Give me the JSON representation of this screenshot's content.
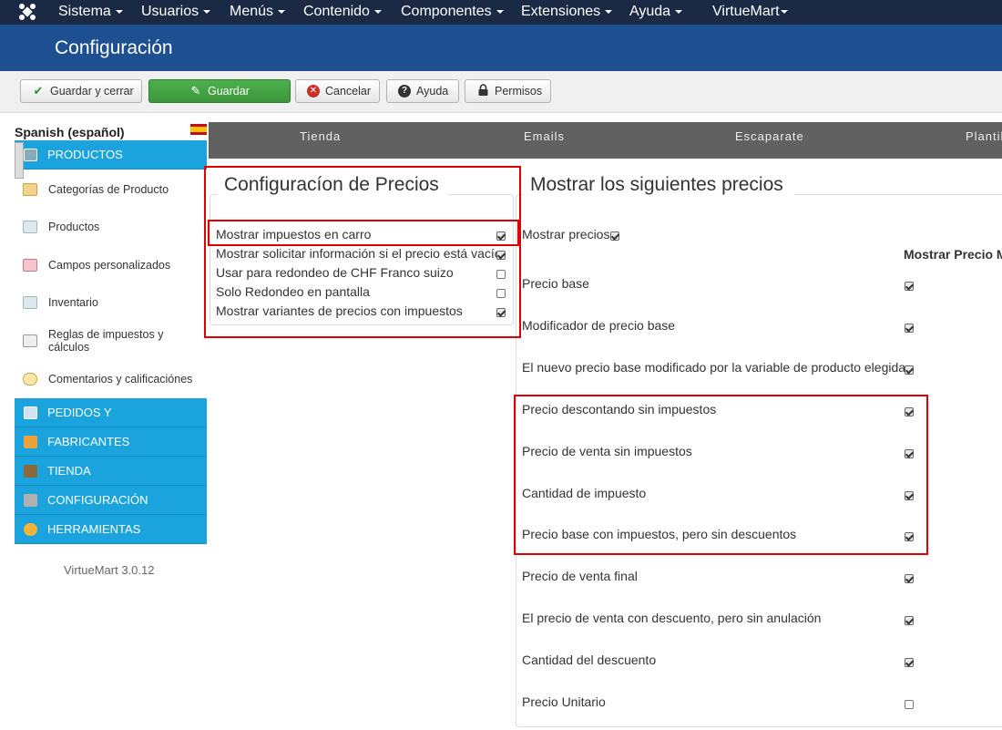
{
  "topnav": {
    "menus": [
      "Sistema",
      "Usuarios",
      "Menús",
      "Contenido",
      "Componentes",
      "Extensiones",
      "Ayuda",
      "VirtueMart"
    ]
  },
  "page_title": "Configuración",
  "toolbar": {
    "save_close": "Guardar y cerrar",
    "save": "Guardar",
    "cancel": "Cancelar",
    "help": "Ayuda",
    "permissions": "Permisos"
  },
  "sidebar": {
    "language": "Spanish (español)",
    "sections": {
      "productos": "PRODUCTOS",
      "pedidos": "PEDIDOS Y",
      "fabricantes": "FABRICANTES",
      "tienda": "TIENDA",
      "configuracion": "CONFIGURACIÓN",
      "herramientas": "HERRAMIENTAS"
    },
    "items": [
      "Categorías de Producto",
      "Productos",
      "Campos personalizados",
      "Inventario",
      "Reglas de impuestos y cálculos",
      "Comentarios y calificaciónes"
    ],
    "version": "VirtueMart 3.0.12"
  },
  "tabs": [
    "Tienda",
    "Emails",
    "Escaparate",
    "Plantil"
  ],
  "price_config": {
    "legend": "Configuracíon de Precios",
    "options": [
      {
        "label": "Mostrar impuestos en carro",
        "checked": true
      },
      {
        "label": "Mostrar solicitar información si el precio está vacío",
        "checked": true
      },
      {
        "label": "Usar para redondeo de CHF Franco suizo",
        "checked": false
      },
      {
        "label": "Solo Redondeo en pantalla",
        "checked": false
      },
      {
        "label": "Mostrar variantes de precios con impuestos",
        "checked": true
      }
    ]
  },
  "show_prices": {
    "legend": "Mostrar los siguientes precios",
    "show_label": "Mostrar precios",
    "show_checked": true,
    "column_header": "Mostrar Precio M",
    "rows": [
      {
        "label": "Precio base",
        "checked": true
      },
      {
        "label": "Modificador de precio base",
        "checked": true
      },
      {
        "label": "El nuevo precio base modificado por la variable de producto elegida",
        "checked": true
      },
      {
        "label": "Precio descontando sin impuestos",
        "checked": true
      },
      {
        "label": "Precio de venta sin impuestos",
        "checked": true
      },
      {
        "label": "Cantidad de impuesto",
        "checked": true
      },
      {
        "label": "Precio base con impuestos, pero sin descuentos",
        "checked": true
      },
      {
        "label": "Precio de venta final",
        "checked": true
      },
      {
        "label": "El precio de venta con descuento, pero sin anulación",
        "checked": true
      },
      {
        "label": "Cantidad del descuento",
        "checked": true
      },
      {
        "label": "Precio Unitario",
        "checked": false
      }
    ]
  },
  "colors": {
    "navbar": "#1a2a44",
    "titlebar": "#1d4f91",
    "sidebar_section": "#1aa3dd",
    "highlight": "#e00000",
    "save_green": "#46a546"
  }
}
